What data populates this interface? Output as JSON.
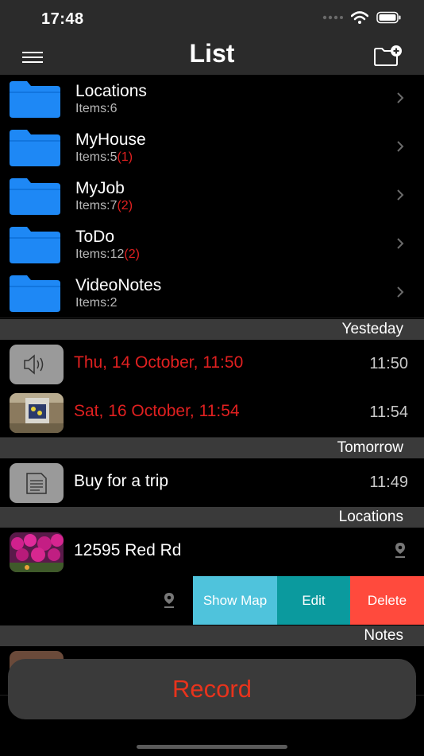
{
  "status": {
    "time": "17:48"
  },
  "nav": {
    "title": "List"
  },
  "folders": [
    {
      "name": "Locations",
      "count": "Items:6",
      "badge": ""
    },
    {
      "name": "MyHouse",
      "count": "Items:5",
      "badge": "(1)"
    },
    {
      "name": "MyJob",
      "count": "Items:7",
      "badge": "(2)"
    },
    {
      "name": "ToDo",
      "count": "Items:12",
      "badge": "(2)"
    },
    {
      "name": "VideoNotes",
      "count": "Items:2",
      "badge": ""
    }
  ],
  "sections": {
    "yesterday": "Yesteday",
    "tomorrow": "Tomorrow",
    "locations": "Locations",
    "notes": "Notes"
  },
  "yesterday_items": [
    {
      "title": "Thu, 14 October, 11:50",
      "time": "11:50",
      "thumb": "speaker-icon"
    },
    {
      "title": "Sat, 16 October, 11:54",
      "time": "11:54",
      "thumb": "photo-thumbnail"
    }
  ],
  "tomorrow_items": [
    {
      "title": "Buy for a trip",
      "time": "11:49",
      "thumb": "document-icon"
    }
  ],
  "location_items": [
    {
      "title": "12595 Red Rd",
      "thumb": "flowers-photo-thumbnail"
    }
  ],
  "swipe_actions": {
    "show_map": "Show Map",
    "edit": "Edit",
    "delete": "Delete"
  },
  "record": {
    "label": "Record"
  },
  "colors": {
    "folder_blue": "#1e88f5",
    "red_text": "#e02020",
    "show_map_bg": "#4fc3dc",
    "edit_bg": "#0b9a9e",
    "delete_bg": "#ff4a3d",
    "record_text": "#e8331c"
  }
}
